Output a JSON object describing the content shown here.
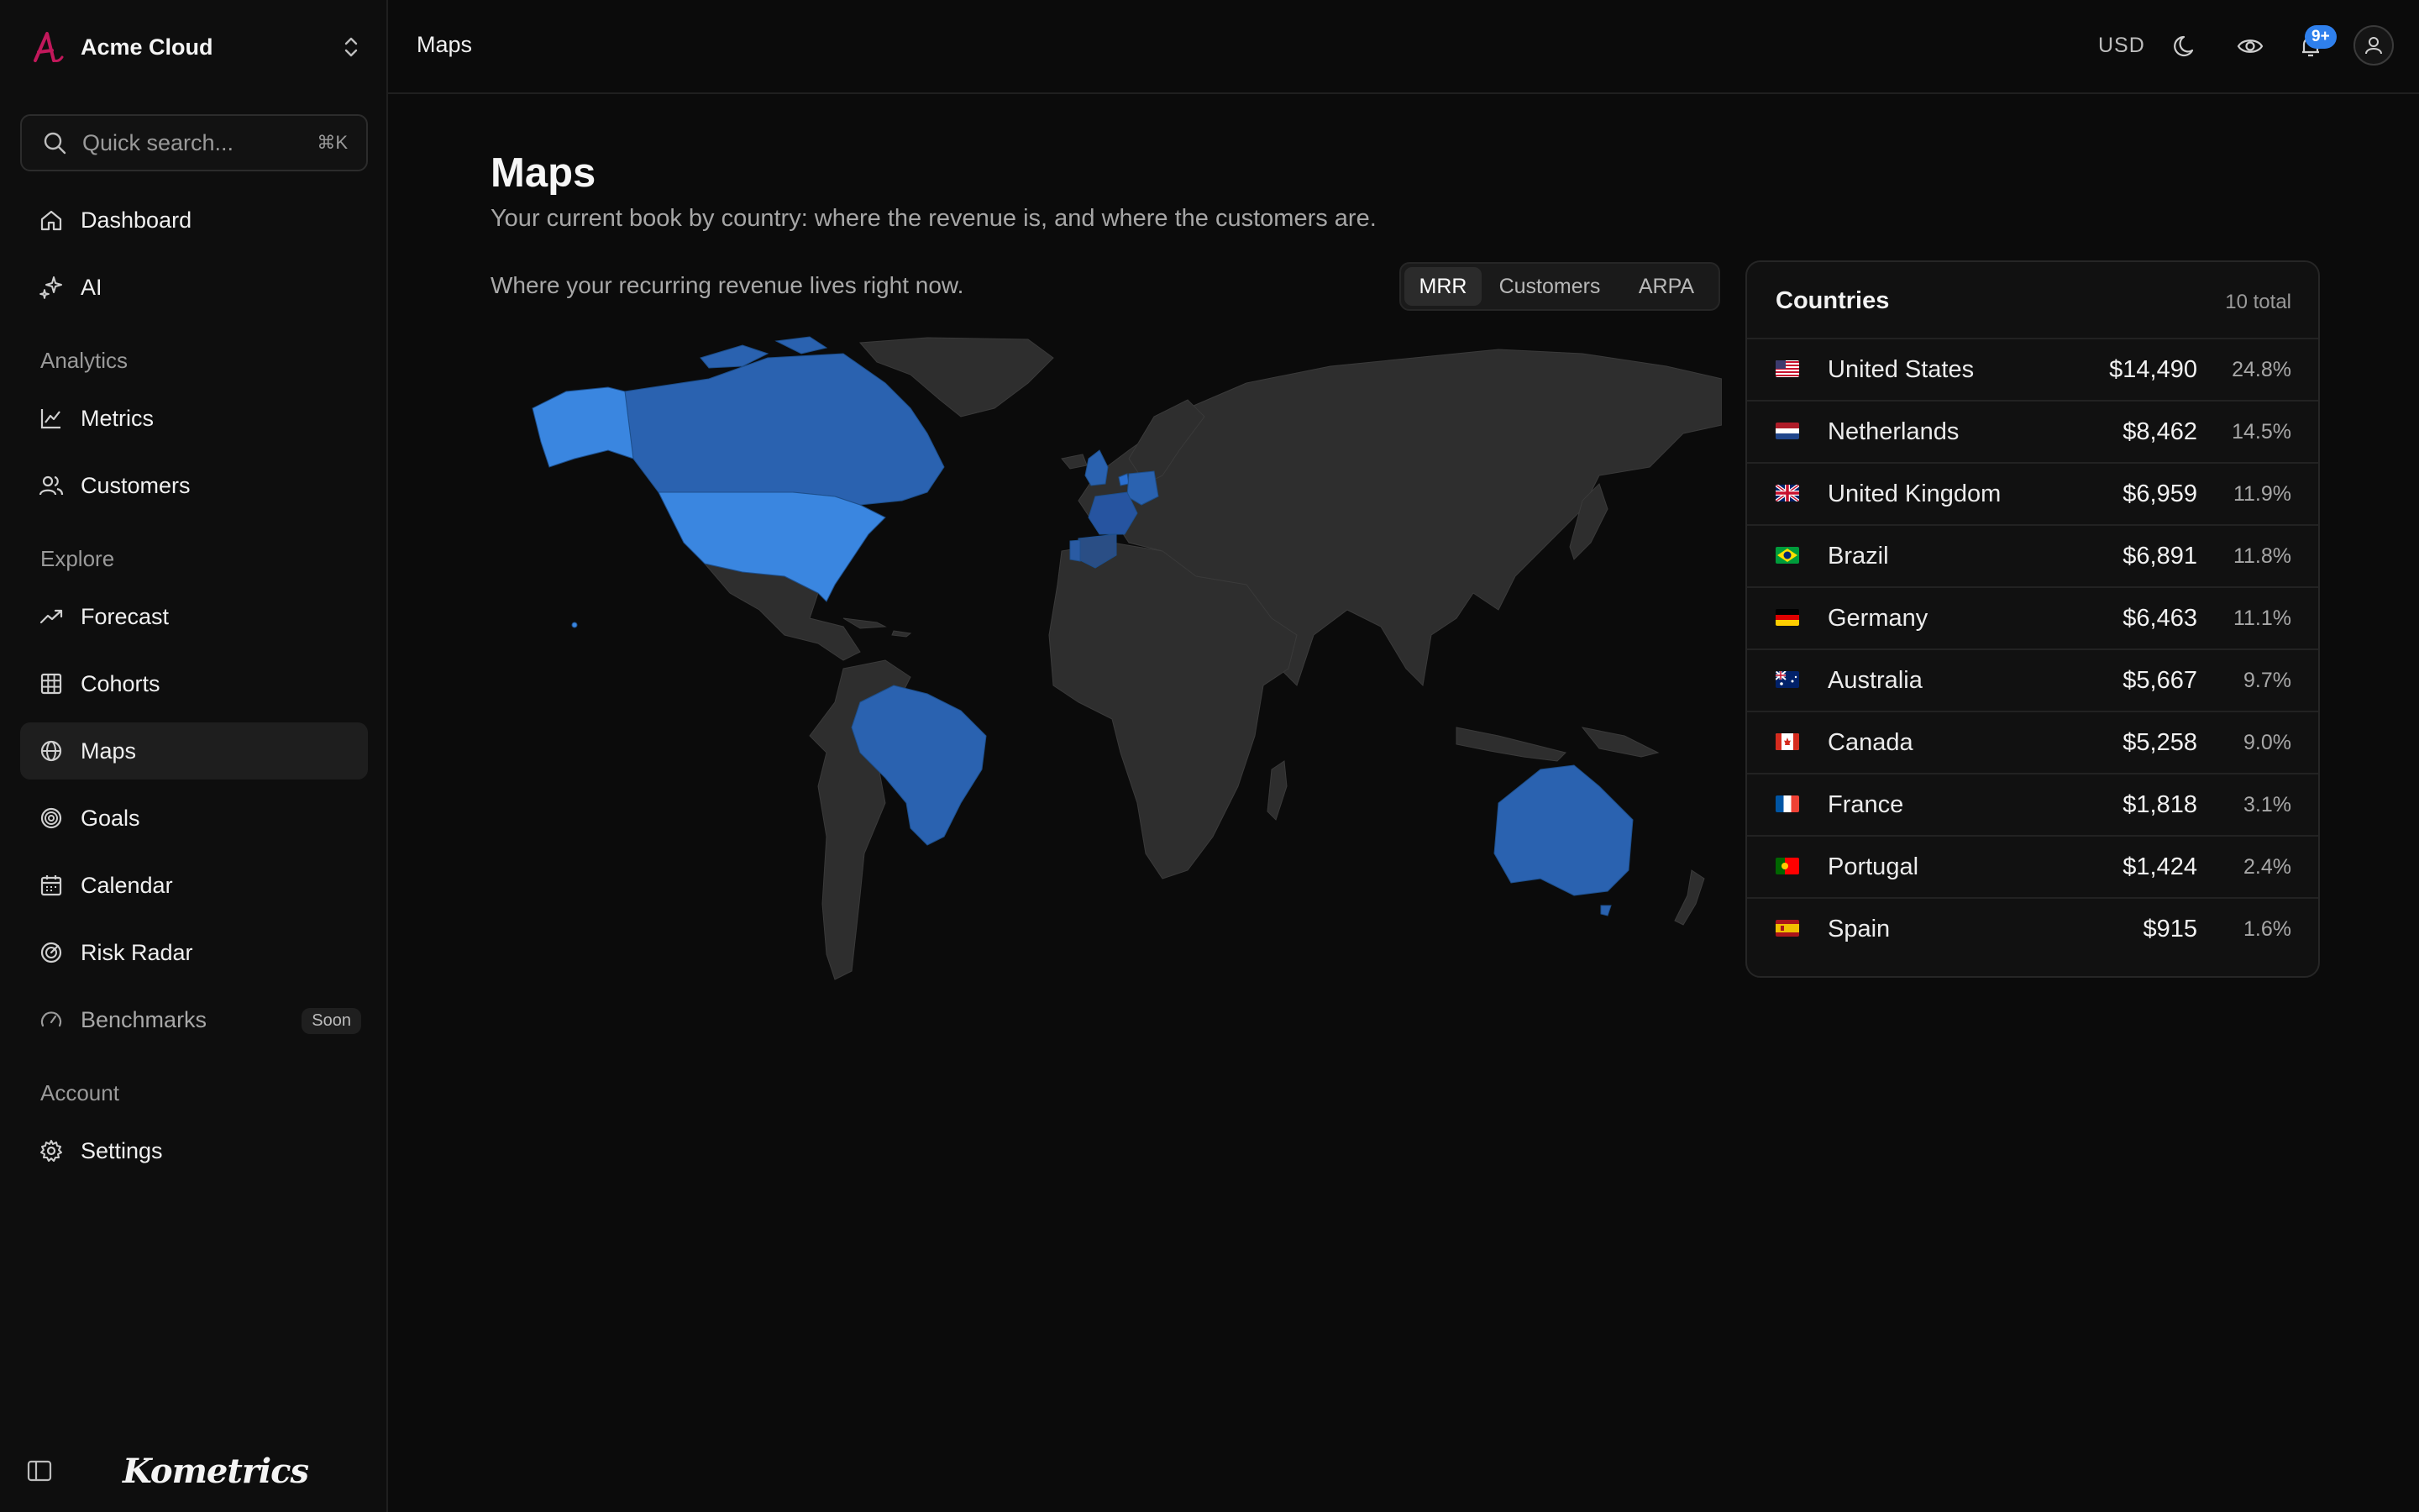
{
  "app": {
    "workspace_name": "Acme Cloud",
    "brand": "Kometrics",
    "accent": "#2f80ed"
  },
  "search": {
    "placeholder": "Quick search...",
    "shortcut": "⌘K"
  },
  "sidebar": {
    "top_items": [
      {
        "label": "Dashboard",
        "icon": "home-icon"
      },
      {
        "label": "AI",
        "icon": "sparkles-icon"
      }
    ],
    "sections": [
      {
        "label": "Analytics",
        "items": [
          {
            "label": "Metrics",
            "icon": "line-chart-icon"
          },
          {
            "label": "Customers",
            "icon": "users-icon"
          }
        ]
      },
      {
        "label": "Explore",
        "items": [
          {
            "label": "Forecast",
            "icon": "trending-up-icon"
          },
          {
            "label": "Cohorts",
            "icon": "grid-icon"
          },
          {
            "label": "Maps",
            "icon": "globe-icon",
            "active": true
          },
          {
            "label": "Goals",
            "icon": "target-icon"
          },
          {
            "label": "Calendar",
            "icon": "calendar-icon"
          },
          {
            "label": "Risk Radar",
            "icon": "radar-icon"
          },
          {
            "label": "Benchmarks",
            "icon": "gauge-icon",
            "badge": "Soon"
          }
        ]
      },
      {
        "label": "Account",
        "items": [
          {
            "label": "Settings",
            "icon": "gear-icon"
          }
        ]
      }
    ]
  },
  "topbar": {
    "breadcrumb": "Maps",
    "currency": "USD",
    "notification_count": "9+"
  },
  "page": {
    "title": "Maps",
    "subtitle": "Your current book by country: where the revenue is, and where the customers are.",
    "map_caption": "Where your recurring revenue lives right now.",
    "metric_tabs": [
      "MRR",
      "Customers",
      "ARPA"
    ],
    "active_tab": "MRR"
  },
  "countries": {
    "title": "Countries",
    "total": "10 total",
    "rows": [
      {
        "name": "United States",
        "amount": "$14,490",
        "share": "24.8%",
        "flag": "us"
      },
      {
        "name": "Netherlands",
        "amount": "$8,462",
        "share": "14.5%",
        "flag": "nl"
      },
      {
        "name": "United Kingdom",
        "amount": "$6,959",
        "share": "11.9%",
        "flag": "gb"
      },
      {
        "name": "Brazil",
        "amount": "$6,891",
        "share": "11.8%",
        "flag": "br"
      },
      {
        "name": "Germany",
        "amount": "$6,463",
        "share": "11.1%",
        "flag": "de"
      },
      {
        "name": "Australia",
        "amount": "$5,667",
        "share": "9.7%",
        "flag": "au"
      },
      {
        "name": "Canada",
        "amount": "$5,258",
        "share": "9.0%",
        "flag": "ca"
      },
      {
        "name": "France",
        "amount": "$1,818",
        "share": "3.1%",
        "flag": "fr"
      },
      {
        "name": "Portugal",
        "amount": "$1,424",
        "share": "2.4%",
        "flag": "pt"
      },
      {
        "name": "Spain",
        "amount": "$915",
        "share": "1.6%",
        "flag": "es"
      }
    ]
  }
}
